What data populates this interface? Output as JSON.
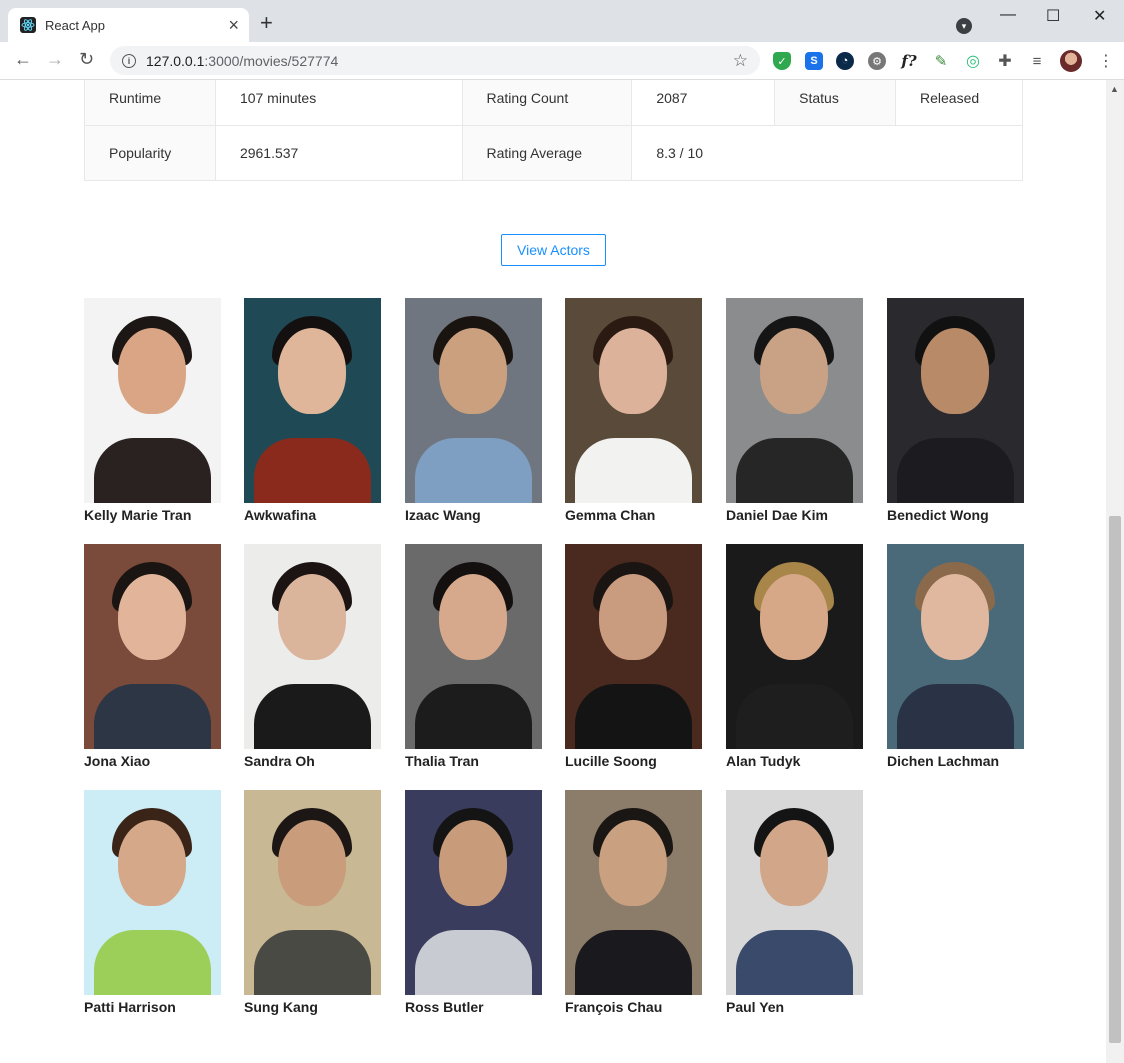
{
  "browser": {
    "tab_title": "React App",
    "url_host": "127.0.0.1",
    "url_path": ":3000/movies/527774"
  },
  "details": {
    "rows": [
      [
        {
          "label": "Runtime",
          "value": "107 minutes"
        },
        {
          "label": "Rating Count",
          "value": "2087"
        },
        {
          "label": "Status",
          "value": "Released"
        }
      ],
      [
        {
          "label": "Popularity",
          "value": "2961.537"
        },
        {
          "label": "Rating Average",
          "value": "8.3 / 10"
        }
      ]
    ]
  },
  "view_actors_label": "View Actors",
  "actors": [
    {
      "name": "Kelly Marie Tran",
      "bg": "#f3f3f3",
      "skin": "#d9a585",
      "hair": "#1c1715",
      "cloth": "#2a2220"
    },
    {
      "name": "Awkwafina",
      "bg": "#1f4a55",
      "skin": "#e0b69b",
      "hair": "#141010",
      "cloth": "#8a2a1c"
    },
    {
      "name": "Izaac Wang",
      "bg": "#6f7680",
      "skin": "#caa07e",
      "hair": "#1a1410",
      "cloth": "#7f9fc2"
    },
    {
      "name": "Gemma Chan",
      "bg": "#5a4a3a",
      "skin": "#dcb29a",
      "hair": "#2a1a12",
      "cloth": "#f2f2f0"
    },
    {
      "name": "Daniel Dae Kim",
      "bg": "#8a8c8e",
      "skin": "#c9a184",
      "hair": "#151515",
      "cloth": "#262626"
    },
    {
      "name": "Benedict Wong",
      "bg": "#2a2a2e",
      "skin": "#b98a68",
      "hair": "#111",
      "cloth": "#1c1c20"
    },
    {
      "name": "Jona Xiao",
      "bg": "#7a4a3a",
      "skin": "#e2b49a",
      "hair": "#1a1412",
      "cloth": "#2c3645"
    },
    {
      "name": "Sandra Oh",
      "bg": "#ececea",
      "skin": "#dbb49c",
      "hair": "#1c1412",
      "cloth": "#1a1a1a"
    },
    {
      "name": "Thalia Tran",
      "bg": "#6a6a6a",
      "skin": "#d6a88c",
      "hair": "#141010",
      "cloth": "#1c1c1c"
    },
    {
      "name": "Lucille Soong",
      "bg": "#4a2a1e",
      "skin": "#c99c80",
      "hair": "#1a1412",
      "cloth": "#141414"
    },
    {
      "name": "Alan Tudyk",
      "bg": "#1a1a1a",
      "skin": "#d6a888",
      "hair": "#a8864a",
      "cloth": "#1e1e1e"
    },
    {
      "name": "Dichen Lachman",
      "bg": "#4a6a7a",
      "skin": "#e0b8a0",
      "hair": "#8a6a4a",
      "cloth": "#2a3245"
    },
    {
      "name": "Patti Harrison",
      "bg": "#ccecf6",
      "skin": "#d6a88a",
      "hair": "#3a2418",
      "cloth": "#9ccf5a"
    },
    {
      "name": "Sung Kang",
      "bg": "#c8b894",
      "skin": "#c99c7c",
      "hair": "#1c1614",
      "cloth": "#4a4a44"
    },
    {
      "name": "Ross Butler",
      "bg": "#3a3c5e",
      "skin": "#c89c7a",
      "hair": "#141414",
      "cloth": "#c8ccd2"
    },
    {
      "name": "François Chau",
      "bg": "#8c7c6a",
      "skin": "#c9a080",
      "hair": "#1a1614",
      "cloth": "#1a1a1e"
    },
    {
      "name": "Paul Yen",
      "bg": "#d8d8d8",
      "skin": "#d2a688",
      "hair": "#141414",
      "cloth": "#3a4a6a"
    }
  ]
}
